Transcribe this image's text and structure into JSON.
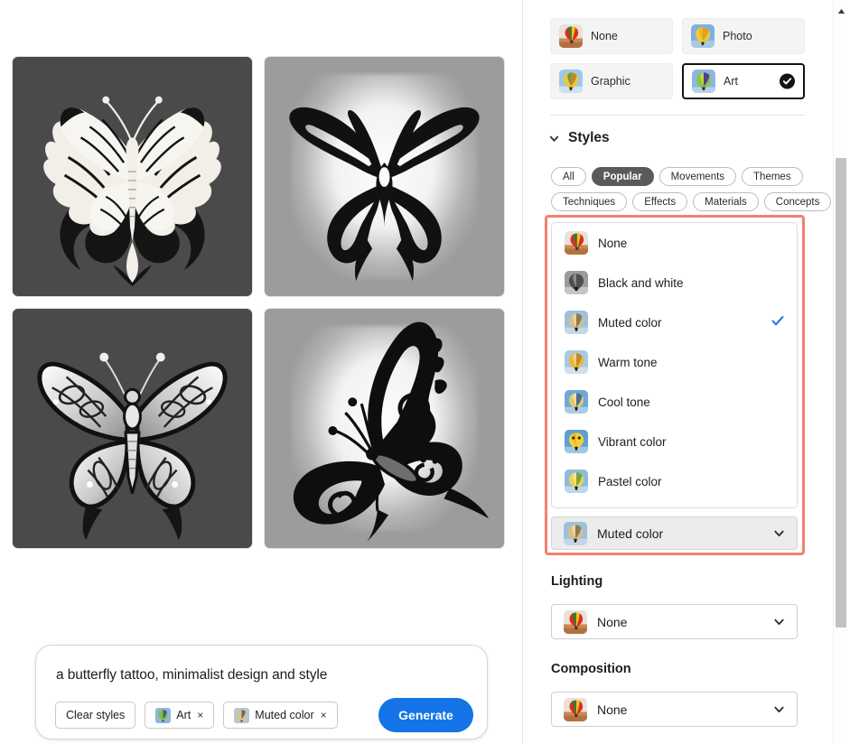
{
  "content_type": {
    "options": [
      {
        "label": "None",
        "icon": "balloon-desert-thumbnail",
        "selected": false
      },
      {
        "label": "Photo",
        "icon": "balloon-photo-thumbnail",
        "selected": false
      },
      {
        "label": "Graphic",
        "icon": "balloon-graphic-thumbnail",
        "selected": false
      },
      {
        "label": "Art",
        "icon": "balloon-art-thumbnail",
        "selected": true
      }
    ]
  },
  "styles": {
    "title": "Styles",
    "expanded": true,
    "filters": [
      {
        "label": "All",
        "active": false
      },
      {
        "label": "Popular",
        "active": true
      },
      {
        "label": "Movements",
        "active": false
      },
      {
        "label": "Themes",
        "active": false
      },
      {
        "label": "Techniques",
        "active": false
      },
      {
        "label": "Effects",
        "active": false
      },
      {
        "label": "Materials",
        "active": false
      },
      {
        "label": "Concepts",
        "active": false
      }
    ],
    "dropdown_open": true,
    "selected": "Muted color",
    "items": [
      {
        "label": "None",
        "checked": false
      },
      {
        "label": "Black and white",
        "checked": false
      },
      {
        "label": "Muted color",
        "checked": true
      },
      {
        "label": "Warm tone",
        "checked": false
      },
      {
        "label": "Cool tone",
        "checked": false
      },
      {
        "label": "Vibrant color",
        "checked": false
      },
      {
        "label": "Pastel color",
        "checked": false
      }
    ]
  },
  "lighting": {
    "label": "Lighting",
    "value": "None"
  },
  "composition": {
    "label": "Composition",
    "value": "None"
  },
  "prompt": {
    "text": "a butterfly tattoo, minimalist design and style",
    "clear_styles_label": "Clear styles",
    "tags": [
      {
        "label": "Art",
        "remove": "×"
      },
      {
        "label": "Muted color",
        "remove": "×"
      }
    ],
    "generate_label": "Generate"
  },
  "results": {
    "images": [
      {
        "name": "butterfly-tattoo-1",
        "background": "#4a4a4a",
        "description": "Symmetrical tribal butterfly tattoo, white wings with black filigree, dark gray background"
      },
      {
        "name": "butterfly-tattoo-2",
        "background": "#9c9c9c",
        "description": "Bold black outline butterfly tattoo on light glow, gray background"
      },
      {
        "name": "butterfly-tattoo-3",
        "background": "#4a4a4a",
        "description": "Grayscale detailed butterfly with shaded wings, dark gray background"
      },
      {
        "name": "butterfly-tattoo-4",
        "background": "#9c9c9c",
        "description": "Side-view ornate swirl butterfly tattoo on light glow, gray background"
      }
    ]
  },
  "colors": {
    "accent_blue": "#1473e6",
    "highlight_red": "#f4806e",
    "chip_active": "#5a5a5a",
    "panel_bg": "#ffffff"
  },
  "scrollbar": {
    "position_percent": 19
  }
}
